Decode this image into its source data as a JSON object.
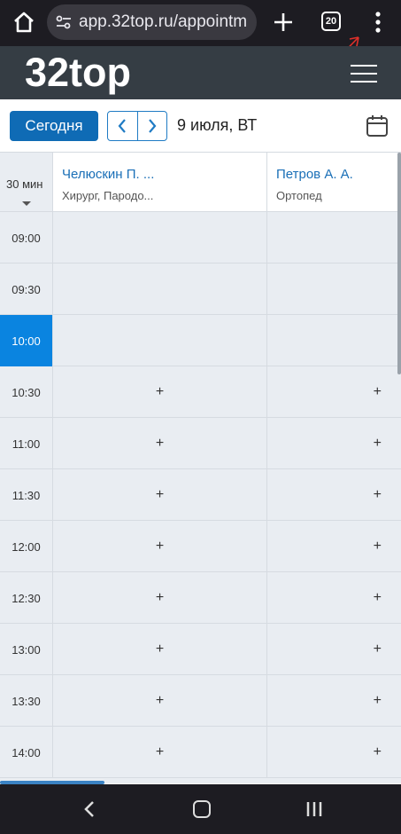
{
  "browser": {
    "url": "app.32top.ru/appointm",
    "tab_count": "20"
  },
  "site": {
    "logo": "32top"
  },
  "toolbar": {
    "today_label": "Сегодня",
    "date_label": "9 июля, ВТ"
  },
  "schedule": {
    "interval_label": "30 мин",
    "doctors": [
      {
        "name": "Челюскин П. ...",
        "specialty": "Хирург, Пародо..."
      },
      {
        "name": "Петров А. А.",
        "specialty": "Ортопед"
      }
    ],
    "slots": [
      {
        "time": "09:00",
        "col1": "",
        "col2": ""
      },
      {
        "time": "09:30",
        "col1": "",
        "col2": ""
      },
      {
        "time": "10:00",
        "col1": "",
        "col2": ""
      },
      {
        "time": "10:30",
        "col1": "+",
        "col2": "+"
      },
      {
        "time": "11:00",
        "col1": "+",
        "col2": "+"
      },
      {
        "time": "11:30",
        "col1": "+",
        "col2": "+"
      },
      {
        "time": "12:00",
        "col1": "+",
        "col2": "+"
      },
      {
        "time": "12:30",
        "col1": "+",
        "col2": "+"
      },
      {
        "time": "13:00",
        "col1": "+",
        "col2": "+"
      },
      {
        "time": "13:30",
        "col1": "+",
        "col2": "+"
      },
      {
        "time": "14:00",
        "col1": "+",
        "col2": "+"
      }
    ],
    "current_time": "10:00"
  },
  "colors": {
    "accent": "#0f6bb5",
    "current_slot": "#0a84e0",
    "header_bg": "#353d44",
    "annotation_arrow": "#e0302a"
  }
}
